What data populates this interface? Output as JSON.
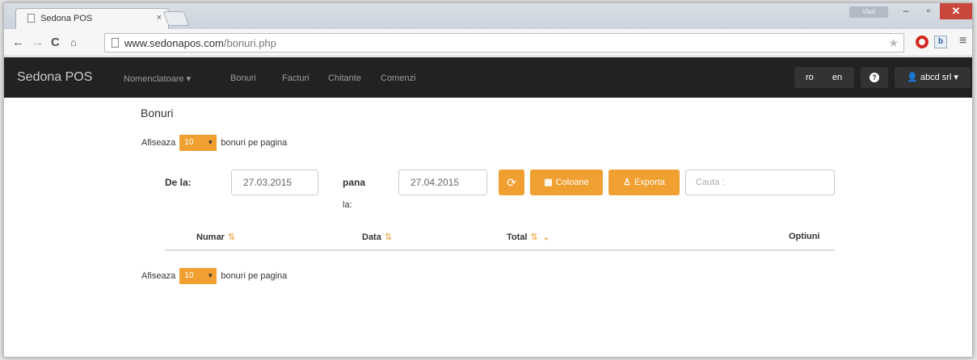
{
  "browser": {
    "tab_title": "Sedona POS",
    "tab_close": "×",
    "window_user": "Vlad",
    "win_minimize": "–",
    "win_restore": "▫",
    "win_close": "✕",
    "url_domain": "www.sedonapos.com",
    "url_path": "/bonuri.php"
  },
  "navbar": {
    "brand": "Sedona POS",
    "items": [
      "Nomenclatoare ▾",
      "Bonuri",
      "Facturi",
      "Chitante",
      "Comenzi"
    ],
    "lang_ro": "ro",
    "lang_en": "en",
    "help": "?",
    "user": "abcd srl ▾"
  },
  "page": {
    "title": "Bonuri",
    "perpage_prefix": "Afiseaza",
    "perpage_value": "10",
    "perpage_suffix": "bonuri pe pagina",
    "from_label": "De la:",
    "from_date": "27.03.2015",
    "to_label_1": "pana",
    "to_label_2": "la:",
    "to_date": "27.04.2015",
    "btn_columns": "Coloane",
    "btn_export": "Exporta",
    "search_placeholder": "Cauta :",
    "columns": [
      "Numar",
      "Data",
      "Total",
      "Optiuni"
    ]
  },
  "colors": {
    "accent": "#f0a030",
    "navbar": "#222222"
  }
}
